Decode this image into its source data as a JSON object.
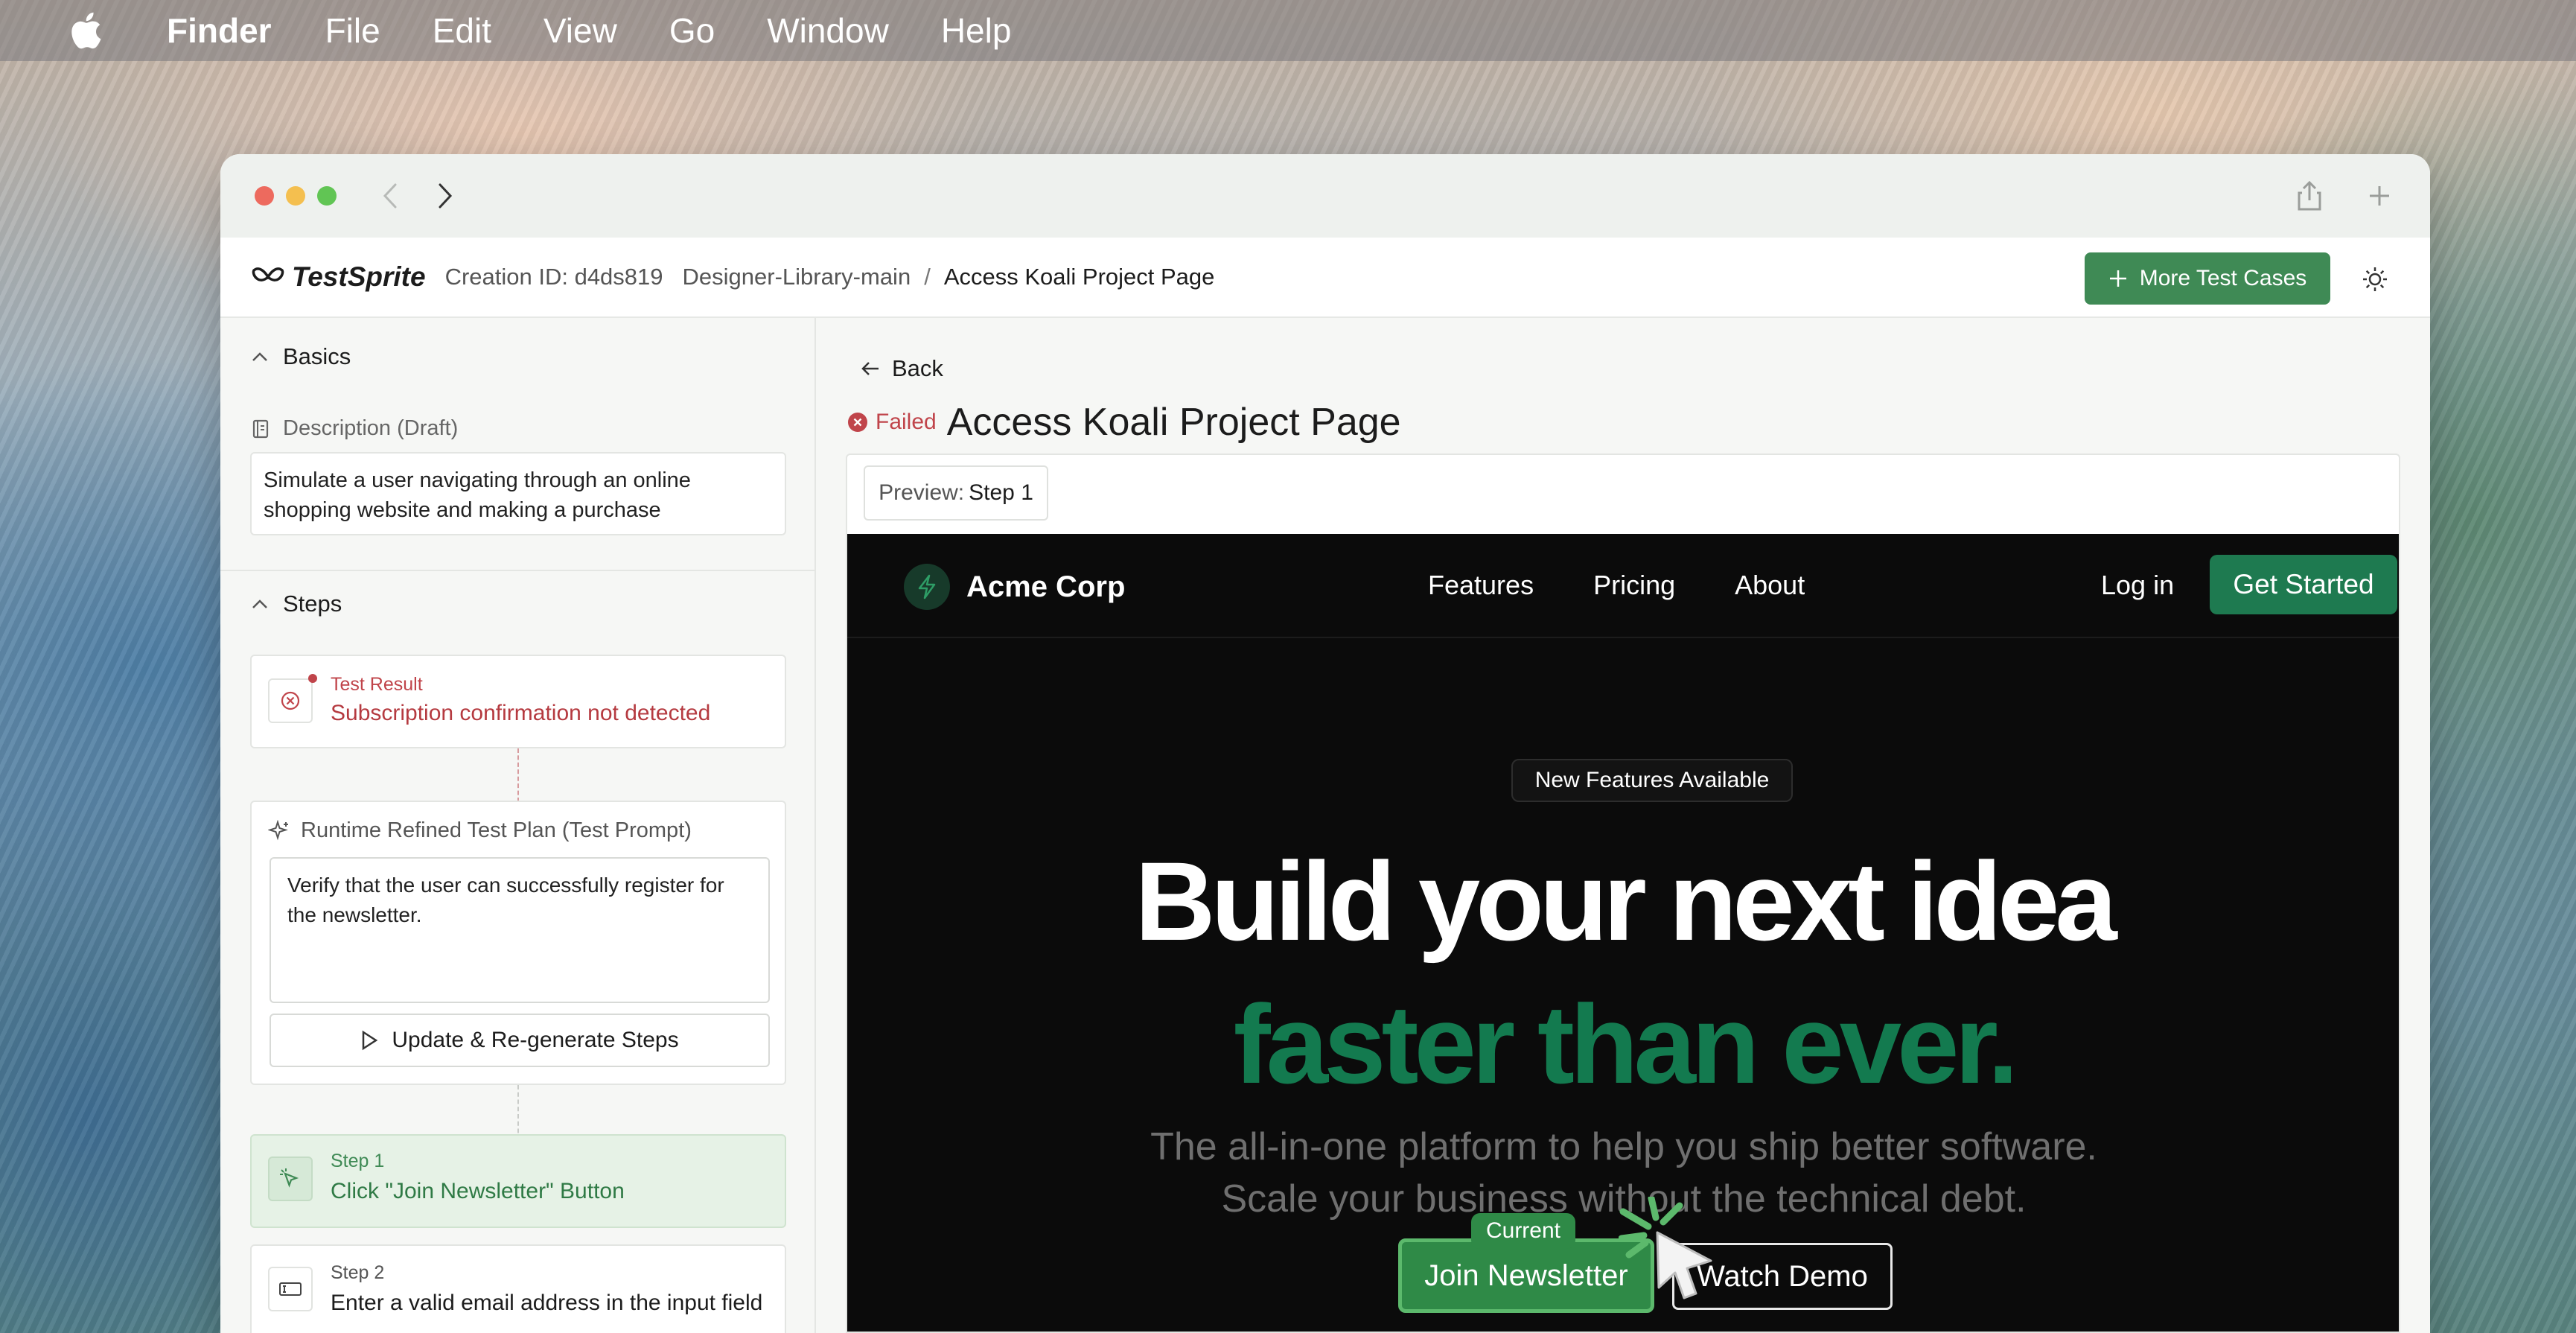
{
  "menubar": {
    "app": "Finder",
    "items": [
      "File",
      "Edit",
      "View",
      "Go",
      "Window",
      "Help"
    ]
  },
  "header": {
    "logo": "TestSprite",
    "creation_id": "Creation ID: d4ds819",
    "breadcrumb": [
      "Designer-Library-main",
      "Access Koali Project Page"
    ],
    "separator": "/",
    "more_button": "More Test Cases"
  },
  "sidebar": {
    "basics_label": "Basics",
    "description_label": "Description (Draft)",
    "description_text": "Simulate a user navigating through an online shopping website and making a purchase",
    "steps_label": "Steps",
    "test_result": {
      "label": "Test Result",
      "value": "Subscription confirmation not detected"
    },
    "plan": {
      "label": "Runtime Refined Test Plan (Test Prompt)",
      "text": "Verify that the user can successfully register for the newsletter.",
      "button": "Update & Re-generate Steps"
    },
    "steps": [
      {
        "num": "Step 1",
        "text": "Click \"Join Newsletter\" Button"
      },
      {
        "num": "Step 2",
        "text": "Enter a valid email address in the input field"
      }
    ]
  },
  "main": {
    "back_label": "Back",
    "status": "Failed",
    "title": "Access Koali Project Page",
    "preview_key": "Preview:",
    "preview_value": "Step 1"
  },
  "site": {
    "brand": "Acme Corp",
    "nav": [
      "Features",
      "Pricing",
      "About"
    ],
    "login": "Log in",
    "get_started": "Get Started",
    "pill": "New Features Available",
    "hero_line1": "Build your next idea",
    "hero_line2": "faster than ever.",
    "sub_line1": "The all-in-one platform to help you ship better software.",
    "sub_line2": "Scale your business without the technical debt.",
    "join": "Join Newsletter",
    "current": "Current",
    "demo": "Watch Demo"
  },
  "colors": {
    "accent_green": "#3f8a55",
    "failed_red": "#c0444a",
    "site_bg": "#0b0b0b",
    "hero_green": "#137a4f"
  }
}
